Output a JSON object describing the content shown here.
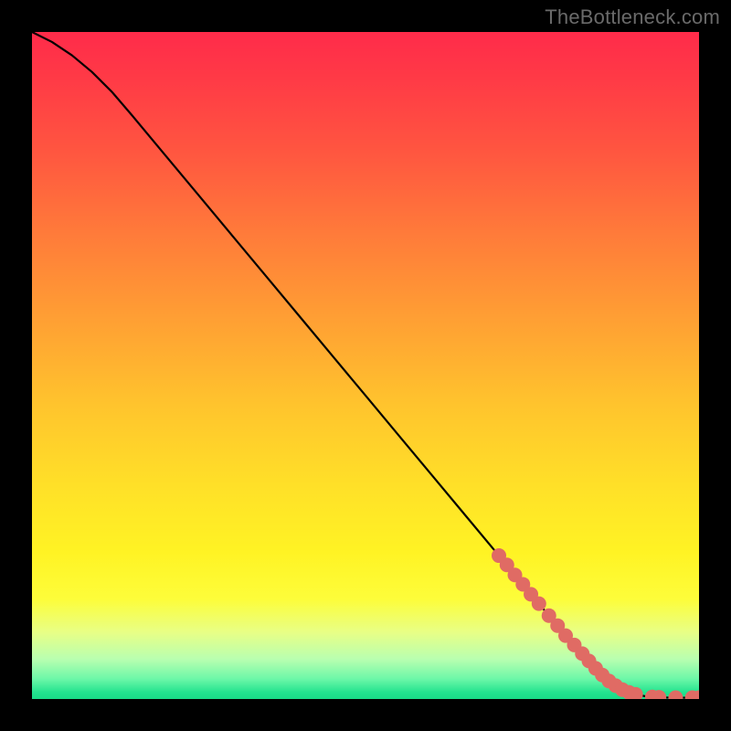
{
  "watermark": "TheBottleneck.com",
  "colors": {
    "point_fill": "#e06b64",
    "line": "#000000"
  },
  "chart_data": {
    "type": "line",
    "title": "",
    "xlabel": "",
    "ylabel": "",
    "xlim": [
      0,
      100
    ],
    "ylim": [
      0,
      100
    ],
    "grid": false,
    "series": [
      {
        "name": "curve",
        "x": [
          0,
          3,
          6,
          9,
          12,
          15,
          20,
          25,
          30,
          35,
          40,
          45,
          50,
          55,
          60,
          65,
          70,
          75,
          80,
          85,
          88,
          90,
          91,
          92,
          93,
          94,
          96,
          98,
          100
        ],
        "y": [
          100,
          98.5,
          96.5,
          94,
          91,
          87.5,
          81.5,
          75.5,
          69.5,
          63.5,
          57.5,
          51.5,
          45.5,
          39.5,
          33.5,
          27.5,
          21.5,
          15.5,
          9.5,
          4.0,
          1.8,
          0.9,
          0.6,
          0.4,
          0.3,
          0.25,
          0.2,
          0.2,
          0.2
        ]
      }
    ],
    "points": [
      {
        "x": 70.0,
        "y": 21.5
      },
      {
        "x": 71.2,
        "y": 20.1
      },
      {
        "x": 72.4,
        "y": 18.6
      },
      {
        "x": 73.6,
        "y": 17.2
      },
      {
        "x": 74.8,
        "y": 15.7
      },
      {
        "x": 76.0,
        "y": 14.3
      },
      {
        "x": 77.5,
        "y": 12.5
      },
      {
        "x": 78.8,
        "y": 11.0
      },
      {
        "x": 80.0,
        "y": 9.5
      },
      {
        "x": 81.3,
        "y": 8.1
      },
      {
        "x": 82.5,
        "y": 6.8
      },
      {
        "x": 83.5,
        "y": 5.7
      },
      {
        "x": 84.5,
        "y": 4.6
      },
      {
        "x": 85.5,
        "y": 3.6
      },
      {
        "x": 86.5,
        "y": 2.7
      },
      {
        "x": 87.5,
        "y": 2.0
      },
      {
        "x": 88.5,
        "y": 1.4
      },
      {
        "x": 89.5,
        "y": 1.0
      },
      {
        "x": 90.5,
        "y": 0.7
      },
      {
        "x": 93.0,
        "y": 0.3
      },
      {
        "x": 94.0,
        "y": 0.25
      },
      {
        "x": 96.5,
        "y": 0.2
      },
      {
        "x": 99.0,
        "y": 0.2
      },
      {
        "x": 100.0,
        "y": 0.2
      }
    ]
  }
}
